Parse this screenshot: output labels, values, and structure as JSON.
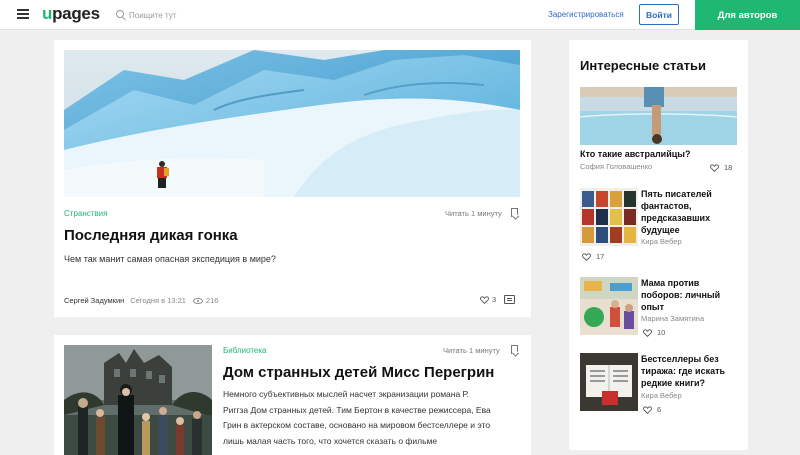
{
  "header": {
    "logo": "upages",
    "search_placeholder": "Поищите тут",
    "register": "Зарегистрироваться",
    "login": "Войти",
    "for_authors": "Для авторов"
  },
  "feed": [
    {
      "tag": "Странствия",
      "read_time": "Читать 1 минуту",
      "title": "Последняя дикая гонка",
      "lede": "Чем так манит самая опасная экспедиция в мире?",
      "author": "Сергей Задумкин",
      "date": "Сегодня в 13:21",
      "views": "216",
      "likes": "3"
    },
    {
      "tag": "Библиотека",
      "read_time": "Читать 1 минуту",
      "title": "Дом странных детей Мисс Перегрин",
      "body_lines": [
        "Немного субъективных мыслей насчет экранизации романа Р.",
        "Риггза Дом странных детей. Тим Бертон в качестве режиссера, Ева",
        "Грин в актерском составе, основано на мировом бестселлере и это",
        "лишь малая часть того, что хочется сказать о фильме"
      ]
    }
  ],
  "sidebar": {
    "heading": "Интересные статьи",
    "featured": {
      "title": "Кто такие австралийцы?",
      "author": "София Головашенко",
      "likes": "18"
    },
    "items": [
      {
        "title_lines": [
          "Пять писателей",
          "фантастов,",
          "предсказавших",
          "будущее"
        ],
        "author": "Кира Вебер",
        "likes": "17"
      },
      {
        "title_lines": [
          "Мама против",
          "поборов: личный",
          "опыт"
        ],
        "author": "Марина Замятина",
        "likes": "10"
      },
      {
        "title_lines": [
          "Бестселлеры без",
          "тиража: где искать",
          "редкие книги?"
        ],
        "author": "Кира Вебер",
        "likes": "6"
      }
    ]
  },
  "colors": {
    "brand_green": "#1fb872",
    "link_blue": "#2e6bbd"
  },
  "icons": [
    "menu-icon",
    "search-icon",
    "bookmark-icon",
    "eye-icon",
    "heart-icon",
    "comment-icon"
  ]
}
